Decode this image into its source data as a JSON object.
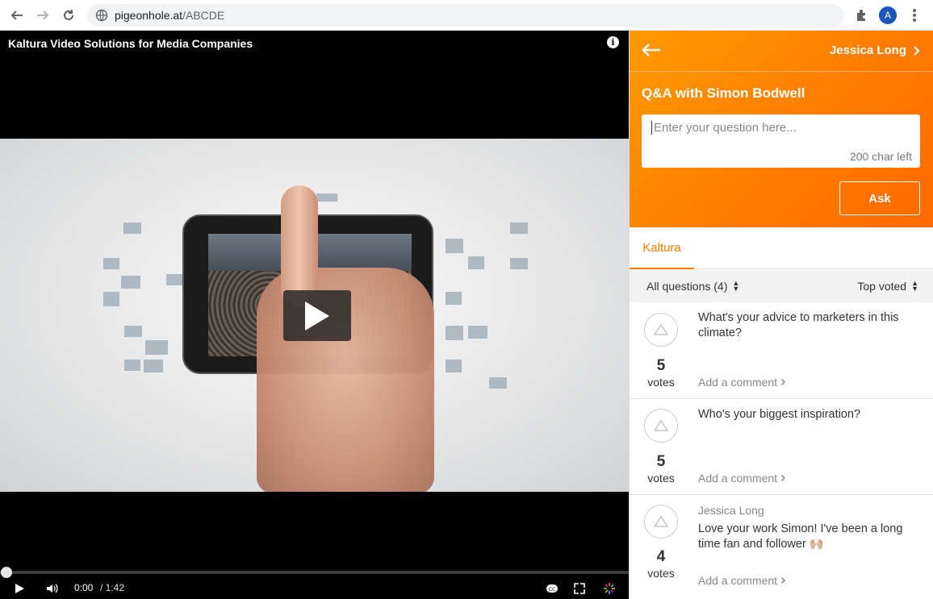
{
  "browser": {
    "url_host": "pigeonhole.at",
    "url_path": "/ABCDE",
    "avatar_letter": "A"
  },
  "video": {
    "title": "Kaltura Video Solutions for Media Companies",
    "info_symbol": "i",
    "current_time": "0:00",
    "duration": "/ 1:42",
    "progress_fraction": 0
  },
  "panel": {
    "user_name": "Jessica Long",
    "session_title": "Q&A with Simon Bodwell",
    "question_placeholder": "Enter your question here...",
    "char_left": "200 char left",
    "ask_label": "Ask",
    "tab_label": "Kaltura",
    "filter_label": "All questions (4)",
    "sort_label": "Top voted",
    "accent_color": "#ff7a00"
  },
  "questions": [
    {
      "text": "What's your advice to marketers in this climate?",
      "votes": "5",
      "votes_label": "votes",
      "comment_label": "Add a comment",
      "author": ""
    },
    {
      "text": "Who's your biggest inspiration?",
      "votes": "5",
      "votes_label": "votes",
      "comment_label": "Add a comment",
      "author": ""
    },
    {
      "text": "Love your work Simon! I've been a long time fan and follower 🙌🏼",
      "votes": "4",
      "votes_label": "votes",
      "comment_label": "Add a comment",
      "author": "Jessica Long"
    }
  ]
}
